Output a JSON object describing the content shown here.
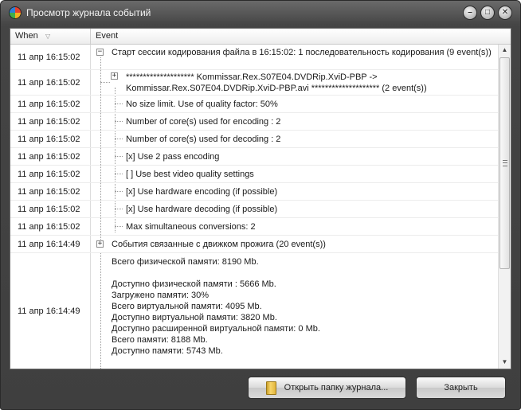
{
  "window": {
    "title": "Просмотр журнала событий",
    "minimize_glyph": "–",
    "maximize_glyph": "□",
    "close_glyph": "✕"
  },
  "columns": {
    "when": "When",
    "event": "Event",
    "sort_glyph": "▽"
  },
  "rows": [
    {
      "when": "11 апр 16:15:02",
      "event": "Старт сессии кодирования файла в 16:15:02: 1 последовательность кодирования (9 event(s))"
    },
    {
      "when": "11 апр 16:15:02",
      "event": "******************** Kommissar.Rex.S07E04.DVDRip.XviD-PBP ->\nKommissar.Rex.S07E04.DVDRip.XviD-PBP.avi ******************** (2 event(s))"
    },
    {
      "when": "11 апр 16:15:02",
      "event": "No size limit. Use of quality factor: 50%"
    },
    {
      "when": "11 апр 16:15:02",
      "event": "Number of core(s) used for encoding : 2"
    },
    {
      "when": "11 апр 16:15:02",
      "event": "Number of core(s) used for decoding : 2"
    },
    {
      "when": "11 апр 16:15:02",
      "event": "[x] Use 2 pass encoding"
    },
    {
      "when": "11 апр 16:15:02",
      "event": "[ ] Use best video quality settings"
    },
    {
      "when": "11 апр 16:15:02",
      "event": "[x] Use hardware encoding (if possible)"
    },
    {
      "when": "11 апр 16:15:02",
      "event": "[x] Use hardware decoding (if possible)"
    },
    {
      "when": "11 апр 16:15:02",
      "event": "Max simultaneous conversions: 2"
    },
    {
      "when": "11 апр 16:14:49",
      "event": "События связанные с движком прожига (20 event(s))"
    },
    {
      "when": "11 апр 16:14:49",
      "event": "Всего физической памяти: 8190 Mb.\n\nДоступно физической памяти : 5666 Mb.\nЗагружено памяти: 30%\nВсего виртуальной памяти: 4095 Mb.\nДоступно виртуальной памяти: 3820 Mb.\nДоступно расширенной виртуальной памяти: 0 Mb.\nВсего памяти: 8188 Mb.\nДоступно памяти: 5743 Mb."
    }
  ],
  "tree": {
    "expanded_glyph": "−",
    "collapsed_glyph": "+"
  },
  "scrollbar": {
    "up_glyph": "▲",
    "down_glyph": "▼"
  },
  "buttons": {
    "open_folder": "Открыть папку журнала...",
    "close": "Закрыть"
  }
}
